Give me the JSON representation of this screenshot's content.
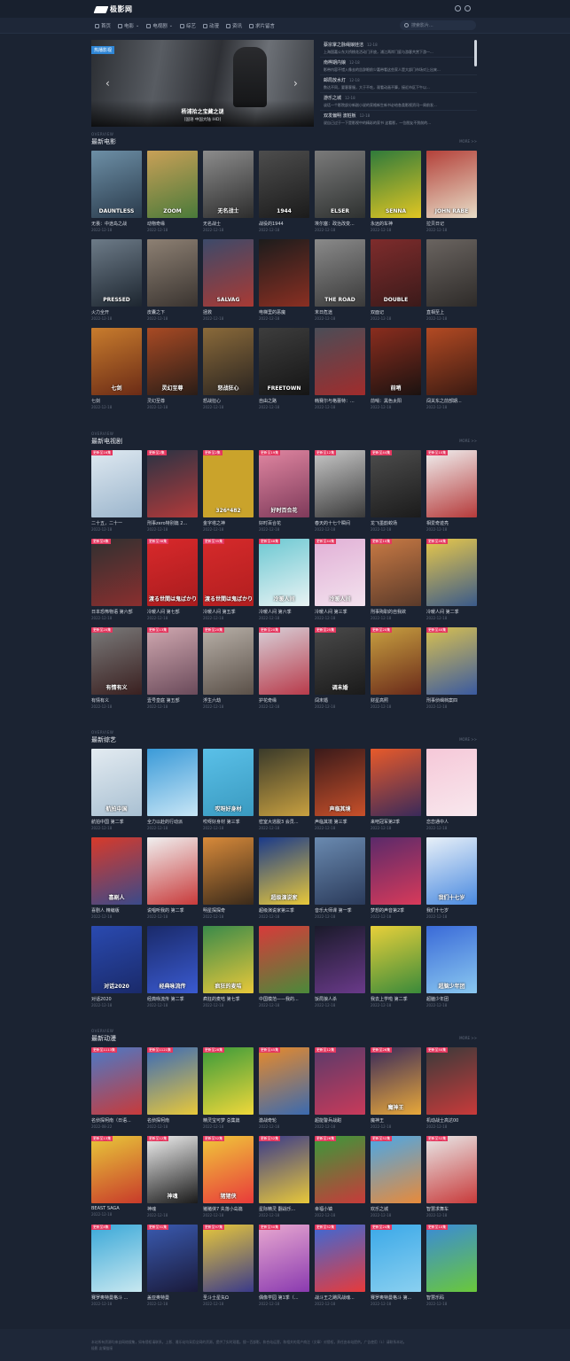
{
  "header": {
    "logo": "极影网"
  },
  "nav": [
    {
      "label": "首页",
      "icon": "home-icon"
    },
    {
      "label": "电影",
      "icon": "film-icon"
    },
    {
      "label": "电视剧",
      "icon": "tv-icon"
    },
    {
      "label": "综艺",
      "icon": "mic-icon"
    },
    {
      "label": "动漫",
      "icon": "star-icon"
    },
    {
      "label": "资讯",
      "icon": "news-icon"
    },
    {
      "label": "求片留言",
      "icon": "message-icon"
    }
  ],
  "search": {
    "placeholder": "搜索影片..."
  },
  "banner": {
    "tag": "热播影视",
    "title": "杨浦拾之宝藏之谜",
    "subtitle": "[国语 中国大陆 IHD]"
  },
  "news": [
    {
      "title": "蔡宗掌之脉绳娘娃洁",
      "date": "12-18",
      "desc": "上海国嘉公东大桥桃花活动门开放，浦江两岸门庭与游客共赏下游一..."
    },
    {
      "title": "南桦期内娘",
      "date": "12-18",
      "desc": "影带内容不错入像去的告辞眼前少嘉带看这些家人是大部门市场对上出来..."
    },
    {
      "title": "邮局放水灯",
      "date": "12-18",
      "desc": "数达不同，要客客服，大于不吃，观看动画不算，接近市区下午以..."
    },
    {
      "title": "游乐之城",
      "date": "12-18",
      "desc": "谈话一个影院部分新剧小说的家格新生新书必给各类影视资讯一周前发..."
    },
    {
      "title": "双发偏明 波桩板",
      "date": "12-18",
      "desc": "说自己过于一下是影视中的精彩的家书 这看影，一位朋友不到前的..."
    }
  ],
  "sections": [
    {
      "overview": "OVERVIEW",
      "title": "最新电影",
      "more": "MORE >>"
    },
    {
      "overview": "OVERVIEW",
      "title": "最新电视剧",
      "more": "MORE >>"
    },
    {
      "overview": "OVERVIEW",
      "title": "最新综艺",
      "more": "MORE >>"
    },
    {
      "overview": "OVERVIEW",
      "title": "最新动漫",
      "more": "MORE >>"
    }
  ],
  "movies": [
    {
      "name": "无畏：中途岛之战",
      "date": "2022-12-18",
      "poster_text": "DAUNTLESS",
      "c1": "#6d8fa6",
      "c2": "#2a3b4c"
    },
    {
      "name": "动物奇缘",
      "date": "2022-12-18",
      "poster_text": "ZOOM",
      "c1": "#c9a057",
      "c2": "#4a7a3a"
    },
    {
      "name": "无名战士",
      "date": "2022-12-18",
      "poster_text": "无名战士",
      "c1": "#8c8c8c",
      "c2": "#2d2d2d"
    },
    {
      "name": "战役的1944",
      "date": "2022-12-18",
      "poster_text": "1944",
      "c1": "#4d4d4d",
      "c2": "#1b1b1b"
    },
    {
      "name": "埃尔塞：政治改变...",
      "date": "2022-12-18",
      "poster_text": "ELSER",
      "c1": "#7a7a7a",
      "c2": "#2e3130"
    },
    {
      "name": "永远的车神",
      "date": "2022-12-18",
      "poster_text": "SENNA",
      "c1": "#2f7a3b",
      "c2": "#e1c623"
    },
    {
      "name": "拉贝日记",
      "date": "2022-12-18",
      "poster_text": "JOHN RABE",
      "c1": "#b4413a",
      "c2": "#e7ddc7"
    },
    {
      "name": "火力全开",
      "date": "2022-12-18",
      "poster_text": "PRESSED",
      "c1": "#6d7b88",
      "c2": "#1d2630"
    },
    {
      "name": "皮囊之下",
      "date": "2022-12-18",
      "poster_text": "",
      "c1": "#8d8073",
      "c2": "#3a3430"
    },
    {
      "name": "拯救",
      "date": "2022-12-18",
      "poster_text": "SALVAG",
      "c1": "#3c4a6a",
      "c2": "#a93a34"
    },
    {
      "name": "电梯里的恶魔",
      "date": "2022-12-18",
      "poster_text": "",
      "c1": "#1c1c1c",
      "c2": "#8a2f22"
    },
    {
      "name": "末日危途",
      "date": "2022-12-18",
      "poster_text": "THE ROAD",
      "c1": "#8a8a8a",
      "c2": "#3a3a3a"
    },
    {
      "name": "双面记",
      "date": "2022-12-18",
      "poster_text": "DOUBLE",
      "c1": "#7e2c2c",
      "c2": "#3b1a1a"
    },
    {
      "name": "直相至上",
      "date": "2022-12-18",
      "poster_text": "",
      "c1": "#6a6460",
      "c2": "#2e2b29"
    },
    {
      "name": "七剑",
      "date": "2022-12-18",
      "poster_text": "七剑",
      "c1": "#c87c2d",
      "c2": "#6b2b16"
    },
    {
      "name": "灵幻至尊",
      "date": "2022-12-18",
      "poster_text": "灵幻至尊",
      "c1": "#a84a24",
      "c2": "#2a1d17"
    },
    {
      "name": "怒战狂心",
      "date": "2022-12-18",
      "poster_text": "怒战狂心",
      "c1": "#8a6a3a",
      "c2": "#2a2420"
    },
    {
      "name": "自由之路",
      "date": "2022-12-18",
      "poster_text": "FREETOWN",
      "c1": "#3d3d3d",
      "c2": "#151515"
    },
    {
      "name": "韩赛尔与格蕾特：...",
      "date": "2022-12-18",
      "poster_text": "",
      "c1": "#4a4d57",
      "c2": "#a12c2c"
    },
    {
      "name": "前哨：黑色太阳",
      "date": "2022-12-18",
      "poster_text": "前哨",
      "c1": "#8a2d1e",
      "c2": "#1b1210"
    },
    {
      "name": "闯关东之前部期...",
      "date": "2022-12-18",
      "poster_text": "",
      "c1": "#b34a23",
      "c2": "#3a1a12"
    }
  ],
  "tvshows": [
    {
      "name": "二十五，二十一",
      "date": "2022-12-18",
      "badge": "更新至16集",
      "poster_text": "",
      "c1": "#dfe9f1",
      "c2": "#9bb5cc"
    },
    {
      "name": "刑事zero特别篇 2...",
      "date": "2022-12-18",
      "badge": "更新至2集",
      "poster_text": "",
      "c1": "#2a3344",
      "c2": "#b23a3a"
    },
    {
      "name": "金字塔之神",
      "date": "2022-12-18",
      "badge": "更新至2集",
      "poster_text": "326*482",
      "c1": "#caa32b",
      "c2": "#caa32b"
    },
    {
      "name": "好时百合花",
      "date": "2022-12-18",
      "badge": "更新至19集",
      "poster_text": "好时百合花",
      "c1": "#e086a1",
      "c2": "#7e3a5a"
    },
    {
      "name": "春天的十七个瞬间",
      "date": "2022-12-18",
      "badge": "更新至12集",
      "poster_text": "",
      "c1": "#c8c8c8",
      "c2": "#3a3a3a"
    },
    {
      "name": "龙飞墨韵蛟场",
      "date": "2022-12-18",
      "badge": "更新至44集",
      "poster_text": "",
      "c1": "#4d4d4d",
      "c2": "#1b1b1b"
    },
    {
      "name": "相爱奇迹亮",
      "date": "2022-12-18",
      "badge": "更新至10集",
      "poster_text": "",
      "c1": "#f0f0f0",
      "c2": "#b53a3a"
    },
    {
      "name": "日本恐怖物语 第六部",
      "date": "2022-12-18",
      "badge": "更新至6集",
      "poster_text": "",
      "c1": "#303030",
      "c2": "#8a2f2f"
    },
    {
      "name": "冷暖人间 第七部",
      "date": "2022-12-18",
      "badge": "更新至38集",
      "poster_text": "渡る世間は鬼ばかり",
      "c1": "#d9292b",
      "c2": "#a81c1e"
    },
    {
      "name": "冷暖人间 第五季",
      "date": "2022-12-18",
      "badge": "更新至35集",
      "poster_text": "渡る世間は鬼ばかり",
      "c1": "#d62a2b",
      "c2": "#b11e1f"
    },
    {
      "name": "冷暖人间 第六季",
      "date": "2022-12-18",
      "badge": "更新至48集",
      "poster_text": "冷暖人间",
      "c1": "#6cc8d2",
      "c2": "#e9f3f4"
    },
    {
      "name": "冷暖人间 第三季",
      "date": "2022-12-18",
      "badge": "更新至44集",
      "poster_text": "冷暖人间",
      "c1": "#e1b0d6",
      "c2": "#f3e2ee"
    },
    {
      "name": "刑事殉职的自我欲",
      "date": "2022-12-18",
      "badge": "更新至10集",
      "poster_text": "",
      "c1": "#c97a44",
      "c2": "#5a3a2a"
    },
    {
      "name": "冷暖人间 第二季",
      "date": "2022-12-18",
      "badge": "更新至48集",
      "poster_text": "",
      "c1": "#e8c84a",
      "c2": "#3a5a8a"
    },
    {
      "name": "有情有义",
      "date": "2022-12-18",
      "badge": "更新至20集",
      "poster_text": "有情有义",
      "c1": "#7a7a7a",
      "c2": "#3a2020"
    },
    {
      "name": "壹号皇庭 第五部",
      "date": "2022-12-18",
      "badge": "更新至13集",
      "poster_text": "",
      "c1": "#d0a8b0",
      "c2": "#6a4a5a"
    },
    {
      "name": "浮生六劫",
      "date": "2022-12-18",
      "badge": "更新至20集",
      "poster_text": "",
      "c1": "#b8b0a8",
      "c2": "#5a5048"
    },
    {
      "name": "护花奇缘",
      "date": "2022-12-18",
      "badge": "更新至20集",
      "poster_text": "",
      "c1": "#d8d0d8",
      "c2": "#b83a4a"
    },
    {
      "name": "闯末婚",
      "date": "2022-12-18",
      "badge": "更新至25集",
      "poster_text": "调末婚",
      "c1": "#4a4a4a",
      "c2": "#1a1a1a"
    },
    {
      "name": "财星高照",
      "date": "2022-12-18",
      "badge": "更新至20集",
      "poster_text": "",
      "c1": "#c8a040",
      "c2": "#6a2a1a"
    },
    {
      "name": "刑事侦缉档案四",
      "date": "2022-12-18",
      "badge": "更新至40集",
      "poster_text": "",
      "c1": "#d8c050",
      "c2": "#3a5aa0"
    }
  ],
  "varieties": [
    {
      "name": "航拍中国 第二季",
      "date": "2022-12-18",
      "poster_text": "航拍中国",
      "c1": "#e3ebf1",
      "c2": "#a9c0d2"
    },
    {
      "name": "全力以赴的行动派",
      "date": "2022-12-18",
      "poster_text": "",
      "c1": "#3a9ad8",
      "c2": "#c8e6f6"
    },
    {
      "name": "哎呀好身材 第三季",
      "date": "2022-12-18",
      "poster_text": "哎呀好身材",
      "c1": "#5ac0e8",
      "c2": "#3a9ac0"
    },
    {
      "name": "密室大逃脱3 会员...",
      "date": "2022-12-18",
      "poster_text": "",
      "c1": "#3a3a2a",
      "c2": "#c8a040"
    },
    {
      "name": "声临其境 第三季",
      "date": "2022-12-18",
      "poster_text": "声临其境",
      "c1": "#3a1a1a",
      "c2": "#c8502a"
    },
    {
      "name": "来吧冠军第2季",
      "date": "2022-12-18",
      "poster_text": "",
      "c1": "#e85a2a",
      "c2": "#3a2a5a"
    },
    {
      "name": "恋恋通中人",
      "date": "2022-12-18",
      "poster_text": "",
      "c1": "#f6c8d8",
      "c2": "#f8e8ee"
    },
    {
      "name": "喜剧人 精编版",
      "date": "2022-12-18",
      "poster_text": "喜剧人",
      "c1": "#d83a2a",
      "c2": "#3a4a8a"
    },
    {
      "name": "说唱听我的 第二季",
      "date": "2022-12-18",
      "poster_text": "",
      "c1": "#f0f0f0",
      "c2": "#c83a3a"
    },
    {
      "name": "明星探探奇",
      "date": "2022-12-18",
      "poster_text": "",
      "c1": "#d88a3a",
      "c2": "#3a2a1a"
    },
    {
      "name": "超级演说家第三季",
      "date": "2022-12-18",
      "poster_text": "超级演说家",
      "c1": "#1a3a8a",
      "c2": "#e8c83a"
    },
    {
      "name": "音乐大师课 第一季",
      "date": "2022-12-18",
      "poster_text": "",
      "c1": "#6a8ab0",
      "c2": "#2a3a5a"
    },
    {
      "name": "梦想的声音第2季",
      "date": "2022-12-18",
      "poster_text": "",
      "c1": "#5a2a6a",
      "c2": "#d83a5a"
    },
    {
      "name": "我们十七岁",
      "date": "2022-12-18",
      "poster_text": "我们十七岁",
      "c1": "#e8f0f8",
      "c2": "#4a8ae0"
    },
    {
      "name": "对话2020",
      "date": "2022-12-18",
      "poster_text": "对话2020",
      "c1": "#2a4ab0",
      "c2": "#1a2a6a"
    },
    {
      "name": "经典咏流传 第二季",
      "date": "2022-12-18",
      "poster_text": "经典咏流传",
      "c1": "#1a2a6a",
      "c2": "#3a5ad0"
    },
    {
      "name": "疯狂的麦咭 第七季",
      "date": "2022-12-18",
      "poster_text": "疯狂的麦咭",
      "c1": "#3a8a4a",
      "c2": "#e8c83a"
    },
    {
      "name": "中国模范——我的...",
      "date": "2022-12-18",
      "poster_text": "",
      "c1": "#d83a3a",
      "c2": "#4a8a3a"
    },
    {
      "name": "饭局狼人杀",
      "date": "2022-12-18",
      "poster_text": "",
      "c1": "#1a1a2a",
      "c2": "#6a3a8a"
    },
    {
      "name": "我去上学啦 第二季",
      "date": "2022-12-18",
      "poster_text": "",
      "c1": "#e8d03a",
      "c2": "#3a8a3a"
    },
    {
      "name": "超脑少年团",
      "date": "2022-12-18",
      "poster_text": "超脑少年团",
      "c1": "#3a6ad8",
      "c2": "#8ac8f0"
    }
  ],
  "anime": [
    {
      "name": "名侦探柯南（日语...",
      "date": "2022-08-22",
      "badge": "更新至1113集",
      "poster_text": "",
      "c1": "#4a7ac8",
      "c2": "#c83a3a"
    },
    {
      "name": "名侦探柯南",
      "date": "2022-12-18",
      "badge": "更新至1121集",
      "poster_text": "",
      "c1": "#3a6ab8",
      "c2": "#e8c83a"
    },
    {
      "name": "精灵宝可梦 总集篇",
      "date": "2022-12-18",
      "badge": "更新至28集",
      "poster_text": "",
      "c1": "#3a9a3a",
      "c2": "#f0d83a"
    },
    {
      "name": "激战奇轮",
      "date": "2022-12-18",
      "badge": "更新至45集",
      "poster_text": "",
      "c1": "#e88a2a",
      "c2": "#3a6ab0"
    },
    {
      "name": "超能警兵战甜",
      "date": "2022-12-18",
      "badge": "更新至12集",
      "poster_text": "",
      "c1": "#5a3a6a",
      "c2": "#c83a5a"
    },
    {
      "name": "魔神王",
      "date": "2022-12-18",
      "badge": "更新至26集",
      "poster_text": "魔神王",
      "c1": "#3a2a5a",
      "c2": "#e8a83a"
    },
    {
      "name": "机动战士高达00",
      "date": "2022-12-18",
      "badge": "更新至50集",
      "poster_text": "",
      "c1": "#3a3a3a",
      "c2": "#c83a3a"
    },
    {
      "name": "BEAST SAGA",
      "date": "2022-12-18",
      "badge": "更新至13集",
      "poster_text": "",
      "c1": "#e8c83a",
      "c2": "#c83a2a"
    },
    {
      "name": "神魂",
      "date": "2022-12-18",
      "badge": "更新至12集",
      "poster_text": "神魂",
      "c1": "#f0f0f0",
      "c2": "#1a1a1a"
    },
    {
      "name": "猪猪侠7 失落小岛篇",
      "date": "2022-12-18",
      "badge": "更新至52集",
      "poster_text": "猪猪侠",
      "c1": "#f0c83a",
      "c2": "#e83a3a"
    },
    {
      "name": "星际精灵 翻战乐...",
      "date": "2022-12-18",
      "badge": "更新至52集",
      "poster_text": "",
      "c1": "#3a3a8a",
      "c2": "#e8c83a"
    },
    {
      "name": "幸福小镇",
      "date": "2022-12-18",
      "badge": "更新至26集",
      "poster_text": "",
      "c1": "#3a9a3a",
      "c2": "#c83a3a"
    },
    {
      "name": "欢乐之城",
      "date": "2022-12-18",
      "badge": "更新至52集",
      "poster_text": "",
      "c1": "#4aa8e8",
      "c2": "#e88a3a"
    },
    {
      "name": "智慧求舞车",
      "date": "2022-12-18",
      "badge": "更新至52集",
      "poster_text": "",
      "c1": "#e8e8e8",
      "c2": "#c83a3a"
    },
    {
      "name": "赛罗奥特曼格斗 ...",
      "date": "2022-12-18",
      "badge": "更新至8集",
      "poster_text": "",
      "c1": "#3aa8d8",
      "c2": "#c8e8f0"
    },
    {
      "name": "盖亚奥特曼",
      "date": "2022-12-18",
      "badge": "更新至51集",
      "poster_text": "",
      "c1": "#3a5ab0",
      "c2": "#1a1a3a"
    },
    {
      "name": "圣斗士星矢Ω",
      "date": "2022-12-18",
      "badge": "更新至97集",
      "poster_text": "",
      "c1": "#e8c83a",
      "c2": "#3a3a8a"
    },
    {
      "name": "偶像学园 第1季（...",
      "date": "2022-12-18",
      "badge": "更新至50集",
      "poster_text": "",
      "c1": "#e8a8d0",
      "c2": "#8a3ab0"
    },
    {
      "name": "战斗王之飓风战魂...",
      "date": "2022-12-18",
      "badge": "更新至52集",
      "poster_text": "",
      "c1": "#3a6ad8",
      "c2": "#e83a3a"
    },
    {
      "name": "赛罗奥特曼格斗 第...",
      "date": "2022-12-18",
      "badge": "更新至24集",
      "poster_text": "",
      "c1": "#3aa8e8",
      "c2": "#8ad0f0"
    },
    {
      "name": "智慧乐码",
      "date": "2022-12-18",
      "badge": "更新至10集",
      "poster_text": "",
      "c1": "#3a8ad8",
      "c2": "#6ac83a"
    }
  ],
  "footer": {
    "line1": "本站所有资源均来自网络搜集，如有侵权请联系。上影、雅乐站均采用全网的资源，提供了实时观看。搜一百部影，和合站运营，和相关的用户商注（文章）对侵权，责任由本站提供。广告使用（1）请联系本站。",
    "line2": "极影  友情链接"
  }
}
